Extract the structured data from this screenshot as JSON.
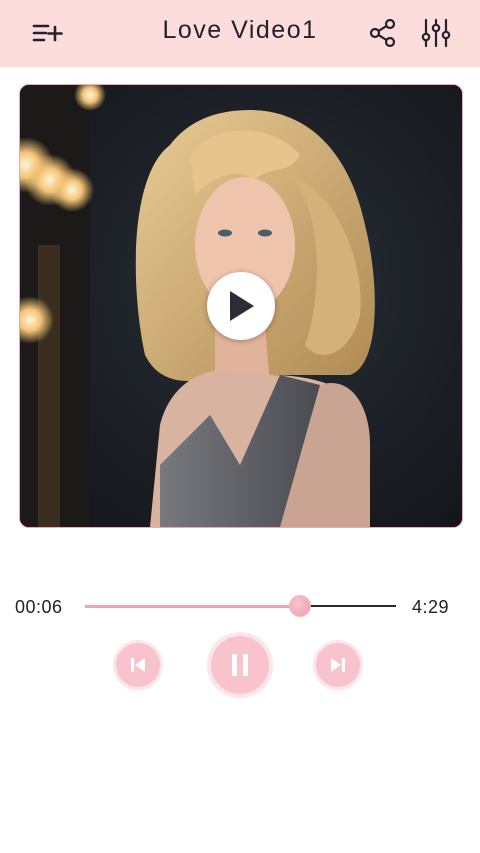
{
  "header": {
    "title": "Love Video1",
    "left_icon": "playlist-add-icon",
    "share_icon": "share-icon",
    "equalizer_icon": "equalizer-icon",
    "background": "#fddcdc"
  },
  "player": {
    "thumbnail_description_icon": "play-icon",
    "current_time": "00:06",
    "total_time": "4:29",
    "progress_fraction": 0.69,
    "accent": "#f0a5b4"
  },
  "controls": {
    "previous_icon": "skip-previous-icon",
    "pause_icon": "pause-icon",
    "next_icon": "skip-next-icon"
  }
}
